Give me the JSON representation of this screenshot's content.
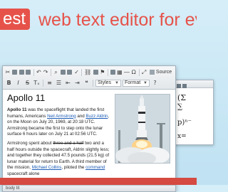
{
  "hero": {
    "badge": "est",
    "tagline": "web text editor for ev"
  },
  "editor": {
    "toolbar": {
      "source_label": "Source",
      "styles_label": "Styles",
      "format_label": "Format"
    },
    "document": {
      "title": "Apollo 11",
      "para1": {
        "bold": "Apollo 11",
        "t1": " was the spaceflight that landed the first humans, Americans ",
        "link1": "Neil Armstrong",
        "t2": " and ",
        "link2": "Buzz Aldrin",
        "t3": ", on the Moon on July 20, 1969, at 20:18 UTC. Armstrong became the first to step onto the lunar surface 6 hours later on July 21 at 02:56 UTC."
      },
      "para2": {
        "t1": "Armstrong spent about ",
        "struck": "three and a half",
        "t2": " two and a half hours outside the spacecraft, Aldrin slightly less; and together they collected 47.5 pounds (21.5 kg) of lunar material for return to Earth. A third member of the mission, ",
        "link1": "Michael Collins",
        "t3": ", piloted the ",
        "link2": "command",
        "t4": " spacecraft alone"
      }
    },
    "statusbar": "body   tit"
  },
  "editor2": {
    "formula1": "(Σ",
    "formula2": "∑",
    "formula3": "p)ⁿ⁻",
    "formula4": "x="
  }
}
